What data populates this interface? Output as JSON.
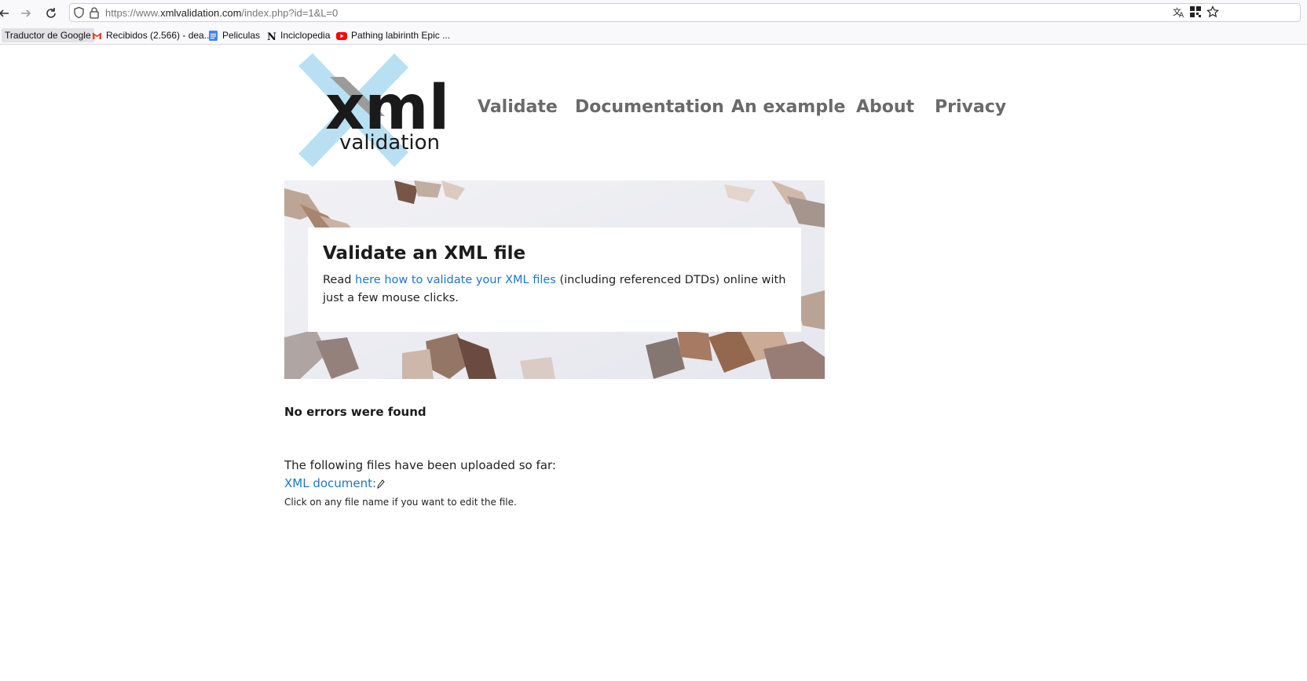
{
  "browser": {
    "url_prefix": "https://www.",
    "url_domain": "xmlvalidation.com",
    "url_path": "/index.php?id=1&L=0",
    "bookmarks": [
      {
        "label": "Traductor de Google",
        "icon": "none"
      },
      {
        "label": "Recibidos (2.566) - dea...",
        "icon": "gmail-icon"
      },
      {
        "label": "Peliculas",
        "icon": "google-docs-icon"
      },
      {
        "label": "Inciclopedia",
        "icon": "inciclopedia-icon"
      },
      {
        "label": "Pathing labirinth Epic ...",
        "icon": "youtube-icon"
      }
    ]
  },
  "logo": {
    "word": "xml",
    "sub": "validation",
    "colors": {
      "x": "#b9e0f2",
      "text": "#1a1a1a",
      "gray": "#9b9b9b"
    }
  },
  "menu": {
    "items": [
      {
        "label": "Validate"
      },
      {
        "label": "Documentation"
      },
      {
        "label": "An example"
      },
      {
        "label": "About"
      },
      {
        "label": "Privacy"
      }
    ]
  },
  "hero": {
    "title": "Validate an XML file",
    "text_before": "Read ",
    "link_text": "here how to validate your XML files",
    "text_after": " (including referenced DTDs) online with just a few mouse clicks."
  },
  "result": {
    "status": "No errors were found",
    "uploaded_intro": "The following files have been uploaded so far:",
    "file_link": "XML document:",
    "hint": "Click on any file name if you want to edit the file."
  },
  "colors": {
    "link": "#1a76d2",
    "menu": "#6a6a6a"
  }
}
